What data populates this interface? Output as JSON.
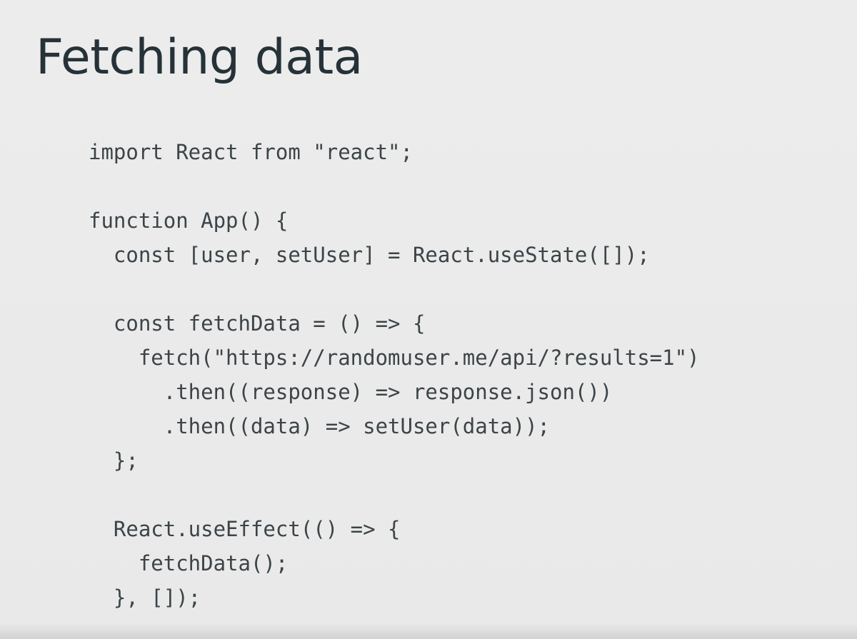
{
  "slide": {
    "title": "Fetching data",
    "code_lines": [
      "import React from \"react\";",
      "",
      "function App() {",
      "  const [user, setUser] = React.useState([]);",
      "",
      "  const fetchData = () => {",
      "    fetch(\"https://randomuser.me/api/?results=1\")",
      "      .then((response) => response.json())",
      "      .then((data) => setUser(data));",
      "  };",
      "",
      "  React.useEffect(() => {",
      "    fetchData();",
      "  }, []);"
    ]
  },
  "colors": {
    "background": "#ebebeb",
    "title": "#263238",
    "code": "#3c4448"
  }
}
